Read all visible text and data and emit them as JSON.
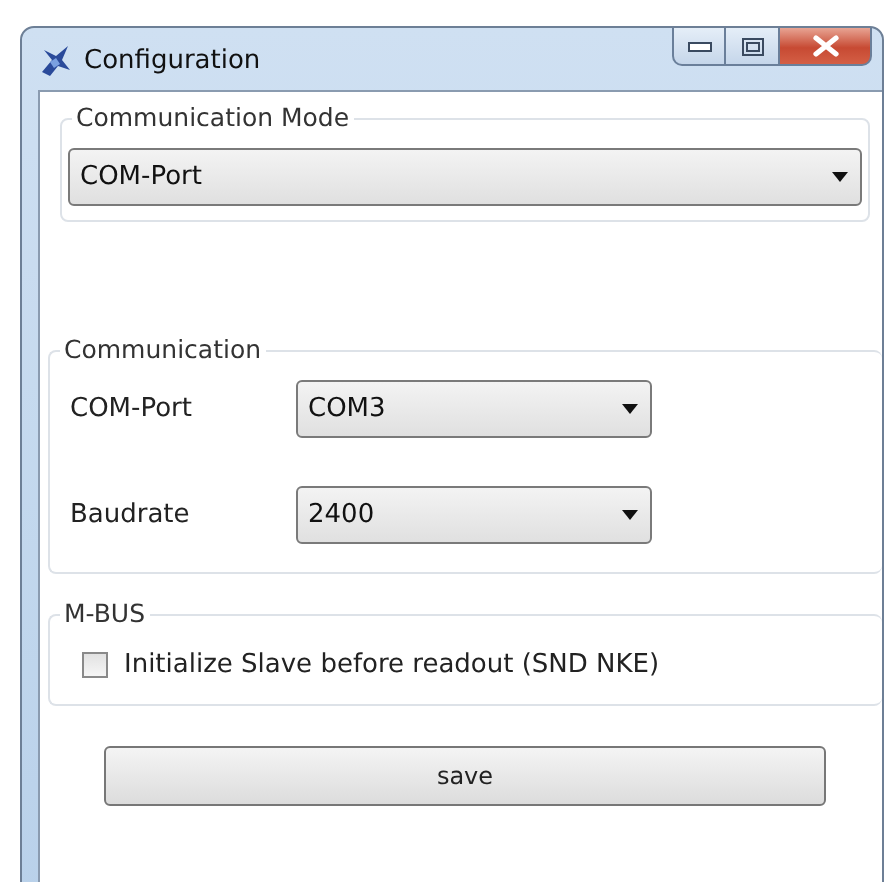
{
  "window": {
    "title": "Configuration"
  },
  "mode_group": {
    "legend": "Communication Mode",
    "dropdown": {
      "value": "COM-Port"
    }
  },
  "communication_group": {
    "legend": "Communication",
    "fields": [
      {
        "label": "COM-Port",
        "value": "COM3"
      },
      {
        "label": "Baudrate",
        "value": "2400"
      }
    ]
  },
  "mbus_group": {
    "legend": "M-BUS",
    "checkbox": {
      "label": "Initialize Slave before readout (SND NKE)",
      "checked": false
    }
  },
  "buttons": [
    "save"
  ]
}
